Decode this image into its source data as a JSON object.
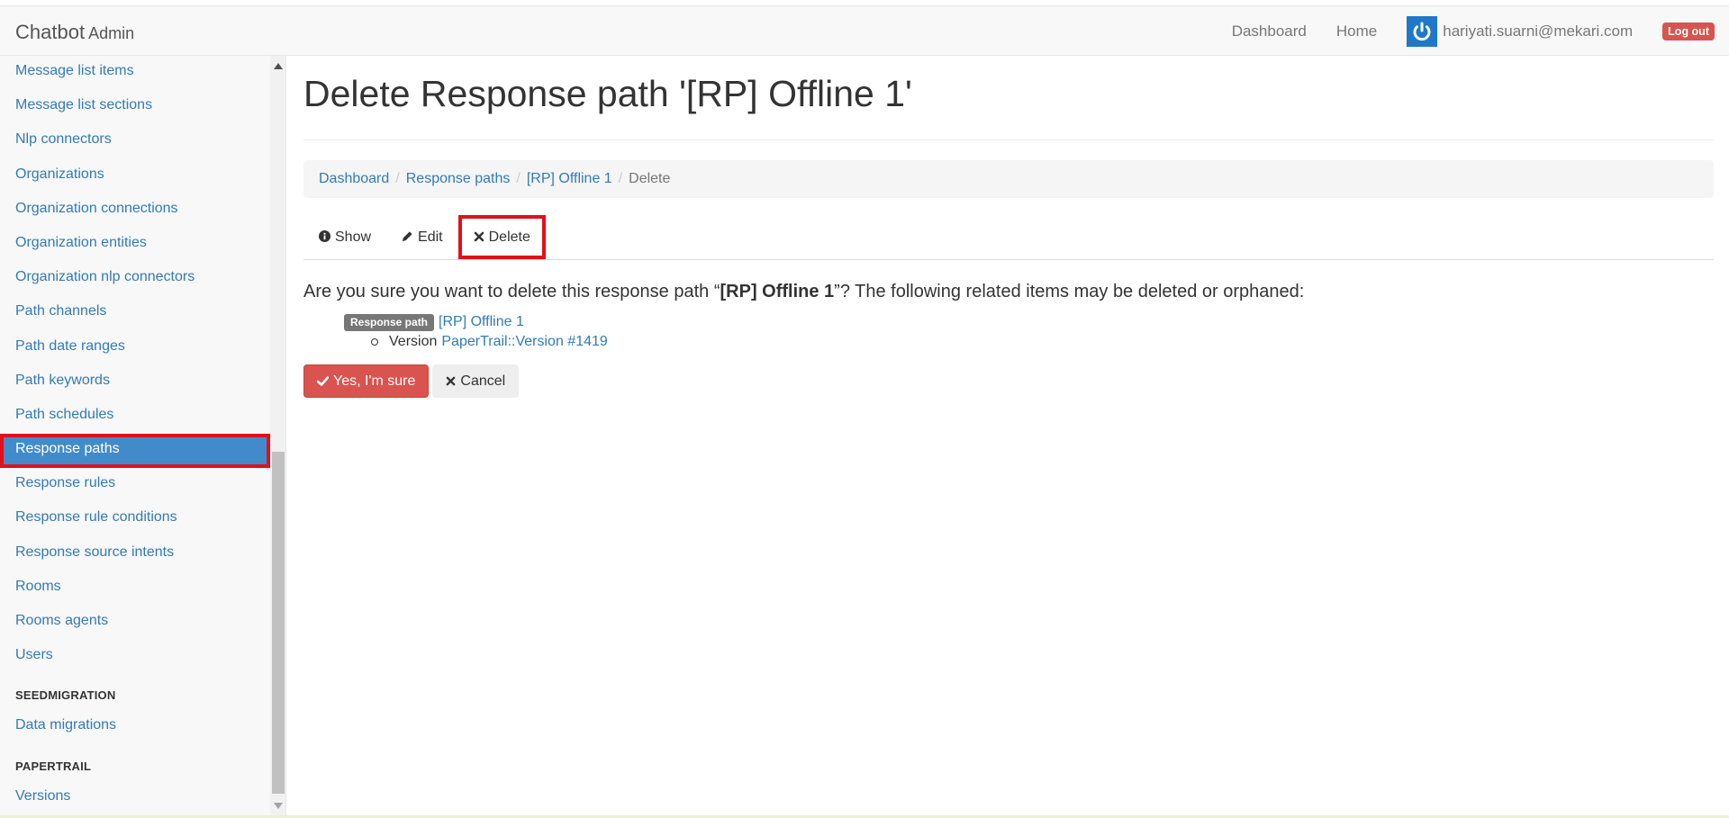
{
  "header": {
    "brand": "Chatbot",
    "brand_sub": "Admin",
    "nav_dashboard": "Dashboard",
    "nav_home": "Home",
    "user_email": "hariyati.suarni@mekari.com",
    "logout": "Log out",
    "avatar_icon": "power-icon"
  },
  "sidebar": {
    "items": [
      "Message list items",
      "Message list sections",
      "Nlp connectors",
      "Organizations",
      "Organization connections",
      "Organization entities",
      "Organization nlp connectors",
      "Path channels",
      "Path date ranges",
      "Path keywords",
      "Path schedules",
      "Response paths",
      "Response rules",
      "Response rule conditions",
      "Response source intents",
      "Rooms",
      "Rooms agents",
      "Users"
    ],
    "active_item": "Response paths",
    "section_seed": "SEEDMIGRATION",
    "seed_items": [
      "Data migrations"
    ],
    "section_papertrail": "PAPERTRAIL",
    "papertrail_items": [
      "Versions"
    ]
  },
  "main": {
    "title": "Delete Response path '[RP] Offline 1'",
    "breadcrumb": {
      "dashboard": "Dashboard",
      "response_paths": "Response paths",
      "record": "[RP] Offline 1",
      "current": "Delete"
    },
    "tabs": {
      "show": "Show",
      "edit": "Edit",
      "delete": "Delete"
    },
    "confirm": {
      "prefix": "Are you sure you want to delete this response path “",
      "name": "[RP] Offline 1",
      "suffix": "”? The following related items may be deleted or orphaned:"
    },
    "related": {
      "label": "Response path",
      "link": "[RP] Offline 1",
      "sub_word": "Version",
      "sub_link": "PaperTrail::Version #1419"
    },
    "buttons": {
      "confirm": "Yes, I'm sure",
      "cancel": "Cancel"
    }
  },
  "colors": {
    "link": "#337ab7",
    "danger": "#d9534f",
    "active_bg": "#428bca",
    "highlight_border": "#e0101c"
  }
}
